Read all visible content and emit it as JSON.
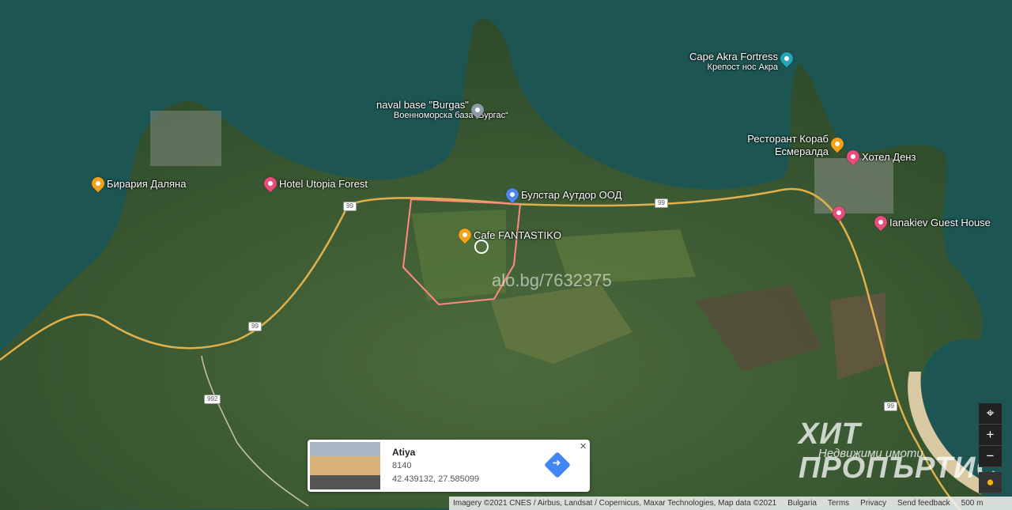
{
  "map": {
    "watermark": "alo.bg/7632375",
    "road_labels": [
      "99",
      "99",
      "99",
      "99",
      "992"
    ],
    "pois": [
      {
        "name": "Бирария Даляна",
        "type": "food"
      },
      {
        "name": "Hotel Utopia Forest",
        "type": "hotel"
      },
      {
        "name": "naval base \"Burgas\"",
        "sub": "Военноморска база „Бургас“",
        "type": "place"
      },
      {
        "name": "Булстар Аутдор ООД",
        "type": "shop"
      },
      {
        "name": "Cafe FANTASTIKO",
        "type": "food"
      },
      {
        "name": "Cape Akra Fortress",
        "sub": "Крепост нос Акра",
        "type": "museum"
      },
      {
        "name": "Ресторант Кораб Есмералда",
        "type": "food"
      },
      {
        "name": "Хотел Денз",
        "type": "hotel"
      },
      {
        "name": "Ianakiev Guest House",
        "type": "hotel"
      }
    ],
    "colors": {
      "plot_outline": "#ff8a80",
      "road": "#e0b04a"
    }
  },
  "place_card": {
    "title": "Atiya",
    "postcode": "8140",
    "coords": "42.439132, 27.585099",
    "close": "×"
  },
  "brand": {
    "line1": "ХИТ ПРОПЪРТИС",
    "line2": "Недвижими имоти"
  },
  "footer": {
    "attribution": "Imagery ©2021 CNES / Airbus, Landsat / Copernicus, Maxar Technologies, Map data ©2021",
    "country": "Bulgaria",
    "terms": "Terms",
    "privacy": "Privacy",
    "feedback": "Send feedback",
    "scale": "500 m"
  },
  "controls": {
    "locate": "⌖",
    "zoom_in": "+",
    "zoom_out": "−"
  }
}
